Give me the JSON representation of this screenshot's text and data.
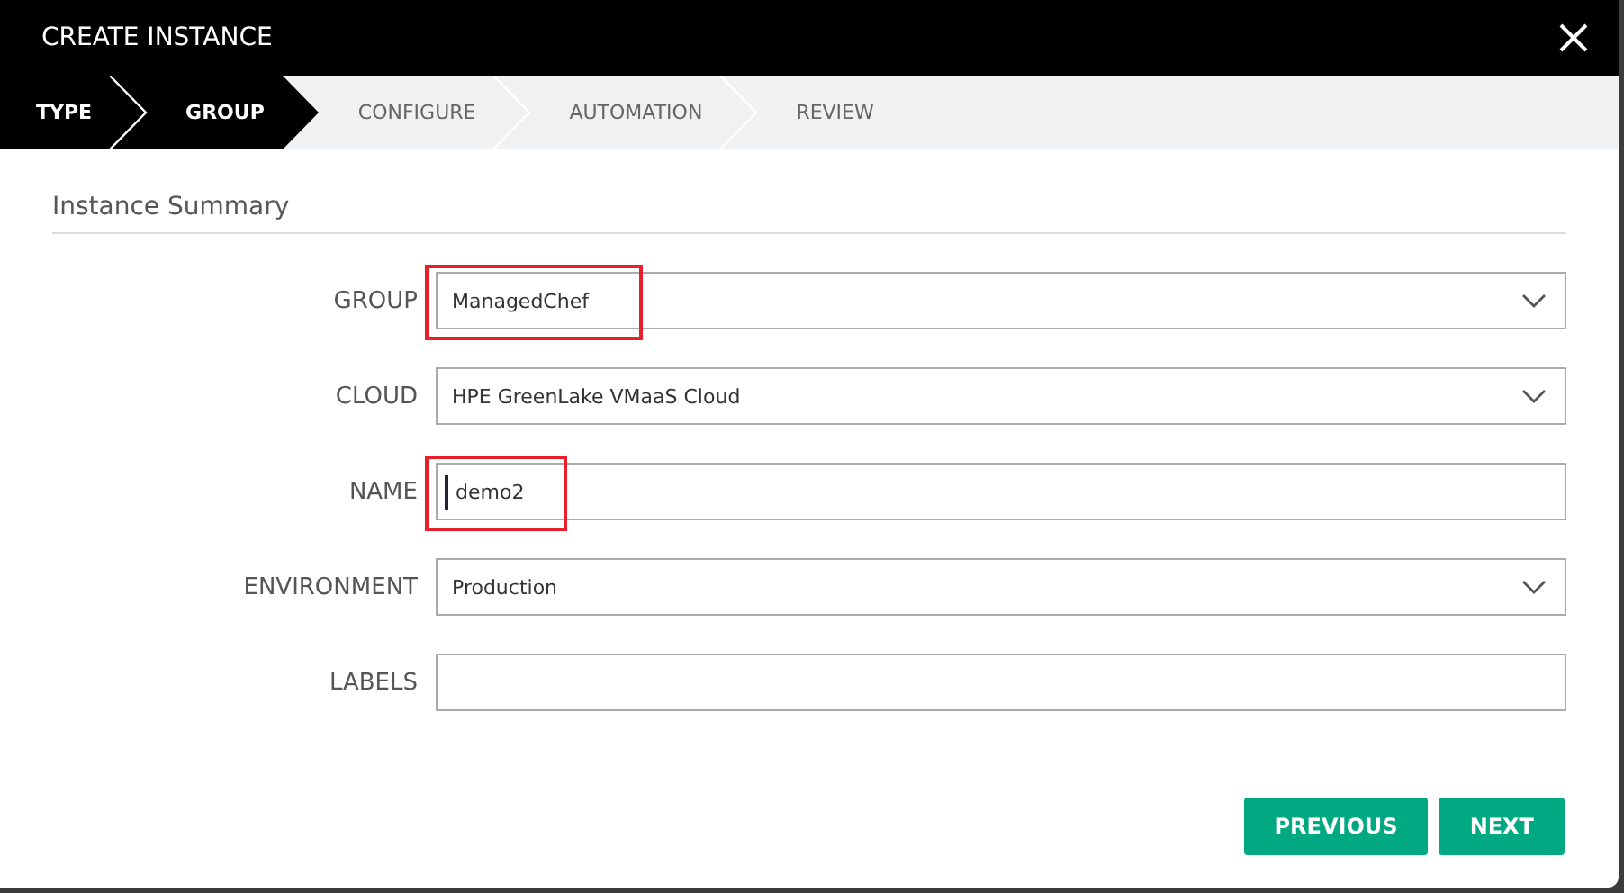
{
  "window": {
    "title": "CREATE INSTANCE"
  },
  "steps": [
    {
      "label": "TYPE",
      "completed": true,
      "selected": false
    },
    {
      "label": "GROUP",
      "completed": false,
      "selected": true
    },
    {
      "label": "CONFIGURE",
      "completed": false,
      "selected": false
    },
    {
      "label": "AUTOMATION",
      "completed": false,
      "selected": false
    },
    {
      "label": "REVIEW",
      "completed": false,
      "selected": false
    }
  ],
  "section_title": "Instance Summary",
  "fields": [
    {
      "label": "GROUP",
      "kind": "select",
      "value": "ManagedChef",
      "highlighted": true,
      "focused": false
    },
    {
      "label": "CLOUD",
      "kind": "select",
      "value": "HPE GreenLake VMaaS Cloud",
      "highlighted": false,
      "focused": false
    },
    {
      "label": "NAME",
      "kind": "text",
      "value": "demo2",
      "highlighted": true,
      "focused": true
    },
    {
      "label": "ENVIRONMENT",
      "kind": "select",
      "value": "Production",
      "highlighted": false,
      "focused": false
    },
    {
      "label": "LABELS",
      "kind": "text",
      "highlighted": false,
      "focused": false
    }
  ],
  "buttons": [
    "PREVIOUS",
    "NEXT"
  ]
}
